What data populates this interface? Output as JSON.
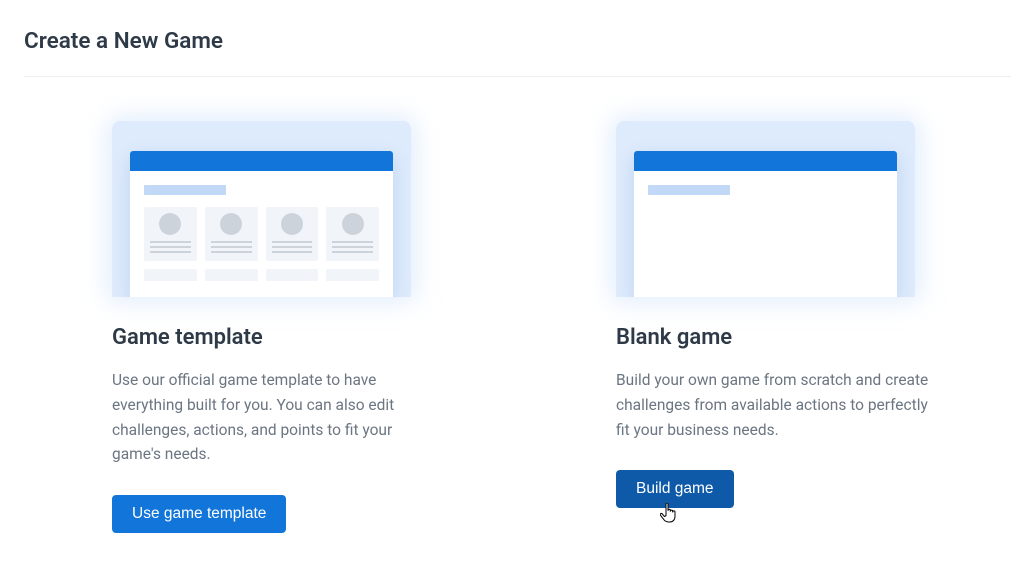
{
  "title": "Create a New Game",
  "cards": [
    {
      "title": "Game template",
      "desc": "Use our official game template to have everything built for you. You can also edit challenges, actions, and points to fit your game's needs.",
      "button": "Use game template"
    },
    {
      "title": "Blank game",
      "desc": "Build your own game from scratch and create challenges from available actions to perfectly fit your business needs.",
      "button": "Build game"
    }
  ]
}
